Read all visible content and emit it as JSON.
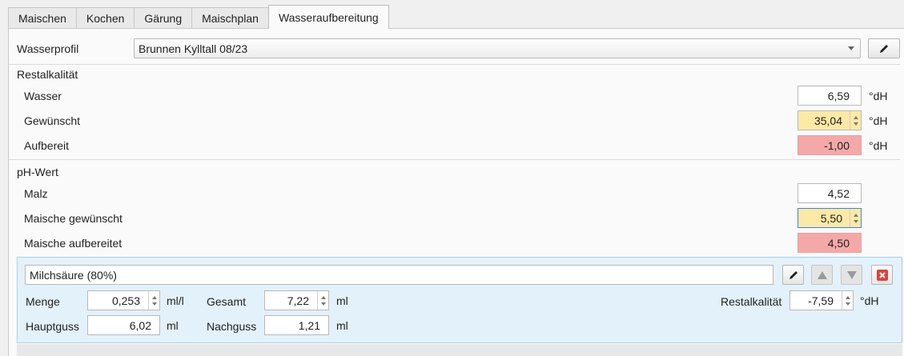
{
  "tabs": [
    {
      "label": "Maischen",
      "active": false
    },
    {
      "label": "Kochen",
      "active": false
    },
    {
      "label": "Gärung",
      "active": false
    },
    {
      "label": "Maischplan",
      "active": false
    },
    {
      "label": "Wasseraufbereitung",
      "active": true
    }
  ],
  "wasserprofil": {
    "label": "Wasserprofil",
    "selected": "Brunnen Kylltall 08/23"
  },
  "restalkalitaet": {
    "heading": "Restalkalität",
    "rows": [
      {
        "label": "Wasser",
        "value": "6,59",
        "unit": "°dH"
      },
      {
        "label": "Gewünscht",
        "value": "35,04",
        "unit": "°dH"
      },
      {
        "label": "Aufbereit",
        "value": "-1,00",
        "unit": "°dH"
      }
    ]
  },
  "ph": {
    "heading": "pH-Wert",
    "rows": [
      {
        "label": "Malz",
        "value": "4,52"
      },
      {
        "label": "Maische gewünscht",
        "value": "5,50"
      },
      {
        "label": "Maische aufbereitet",
        "value": "4,50"
      }
    ]
  },
  "additive": {
    "name": "Milchsäure (80%)",
    "menge_label": "Menge",
    "menge_value": "0,253",
    "menge_unit": "ml/l",
    "gesamt_label": "Gesamt",
    "gesamt_value": "7,22",
    "gesamt_unit": "ml",
    "restalk_label": "Restalkalität",
    "restalk_value": "-7,59",
    "restalk_unit": "°dH",
    "hauptguss_label": "Hauptguss",
    "hauptguss_value": "6,02",
    "hauptguss_unit": "ml",
    "nachguss_label": "Nachguss",
    "nachguss_value": "1,21",
    "nachguss_unit": "ml"
  },
  "colors": {
    "highlight_yellow": "#fde9a6",
    "highlight_red": "#f5a8a8",
    "additive_panel": "#e3f1fa"
  }
}
